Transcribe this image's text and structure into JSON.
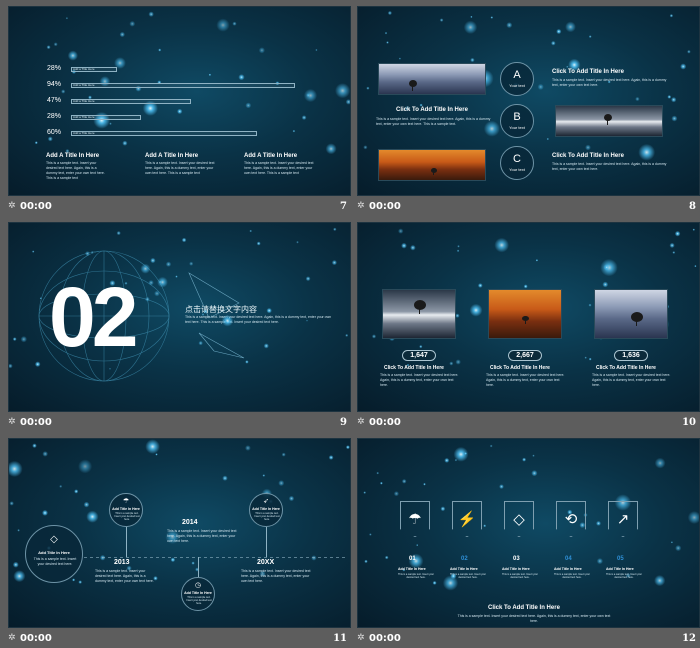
{
  "colors": {
    "background": "#5d5d5d",
    "slide_bg": "#0a3246",
    "accent": "#4fc3f7",
    "text": "#ffffff"
  },
  "footer_icon": "star-transition-icon",
  "slides": [
    {
      "number": "7",
      "time": "00:00",
      "bars": [
        {
          "pct": "28%",
          "label": "Add a Title Here",
          "fill": 0.28
        },
        {
          "pct": "94%",
          "label": "Add a Title Here",
          "fill": 0.94
        },
        {
          "pct": "47%",
          "label": "Add a Title Here",
          "fill": 0.47
        },
        {
          "pct": "28%",
          "label": "Add a Title Here",
          "fill": 0.28
        },
        {
          "pct": "60%",
          "label": "Add a Title Here",
          "fill": 0.6
        }
      ],
      "columns": [
        {
          "title": "Add A Title In Here",
          "body": "This is a sample text. Insert your desired text here. Again, this is a dummy text, enter your own text here. This is a sample text"
        },
        {
          "title": "Add A Title In Here",
          "body": "This is a sample text. Insert your desired text here. Again, this is a dummy text, enter your own text here. This is a sample text"
        },
        {
          "title": "Add A Title In Here",
          "body": "This is a sample text. Insert your desired text here. Again, this is a dummy text, enter your own text here. This is a sample text"
        }
      ]
    },
    {
      "number": "8",
      "time": "00:00",
      "center_title": "Click To Add Title In Here",
      "center_body": "This is a sample text. Insert your desired text here. Again, this is a dummy text, enter your own text here. This is a sample text.",
      "circles": [
        {
          "letter": "A",
          "sub": "Your text"
        },
        {
          "letter": "B",
          "sub": "Your text"
        },
        {
          "letter": "C",
          "sub": "Your text"
        }
      ],
      "side_items": [
        {
          "title": "Click To Add Title In Here",
          "body": "This is a sample text. Insert your desired text here. Again, this is a dummy text, enter your own text here."
        },
        {
          "title": "Click To Add Title In Here",
          "body": "This is a sample text. Insert your desired text here. Again, this is a dummy text, enter your own text here."
        }
      ]
    },
    {
      "number": "9",
      "time": "00:00",
      "big_number": "02",
      "heading": "点击请替换文字内容",
      "body": "This is a sample text. Insert your desired text here. Again, this is a dummy text, enter your own text here. This is a sample text. Insert your desired text here."
    },
    {
      "number": "10",
      "time": "00:00",
      "items": [
        {
          "value": "1,647",
          "title": "Click To Add Title In Here",
          "body": "This is a sample text. Insert your desired text here. Again, this is a dummy text, enter your own text here."
        },
        {
          "value": "2,667",
          "title": "Click To Add Title In Here",
          "body": "This is a sample text. Insert your desired text here. Again, this is a dummy text, enter your own text here."
        },
        {
          "value": "1,636",
          "title": "Click To Add Title In Here",
          "body": "This is a sample text. Insert your desired text here. Again, this is a dummy text, enter your own text here."
        }
      ]
    },
    {
      "number": "11",
      "time": "00:00",
      "years": [
        "2013",
        "2014",
        "20XX"
      ],
      "node_title": "Add Title In Here",
      "node_body": "This is a sample text. Insert your desired text here.",
      "year_body": "This is a sample text. Insert your desired text here. Again, this is a dummy text, enter your own text here."
    },
    {
      "number": "12",
      "time": "00:00",
      "steps": [
        {
          "num": "01",
          "icon": "umbrella-icon",
          "glyph": "☂",
          "color": "#ffffff"
        },
        {
          "num": "02",
          "icon": "shield-bolt-icon",
          "glyph": "⚡",
          "color": "#2e8fd6"
        },
        {
          "num": "03",
          "icon": "diamond-icon",
          "glyph": "◇",
          "color": "#ffffff"
        },
        {
          "num": "04",
          "icon": "history-clock-icon",
          "glyph": "⟲",
          "color": "#2e8fd6"
        },
        {
          "num": "05",
          "icon": "trend-arrow-icon",
          "glyph": "↗",
          "color": "#2e8fd6"
        }
      ],
      "step_title": "Add Title In Here",
      "step_body": "This is a sample text. Insert your desired text here.",
      "footer_title": "Click To Add Title In Here",
      "footer_body": "This is a sample text. Insert your desired text here. Again, this is a dummy text, enter your own text here."
    }
  ]
}
